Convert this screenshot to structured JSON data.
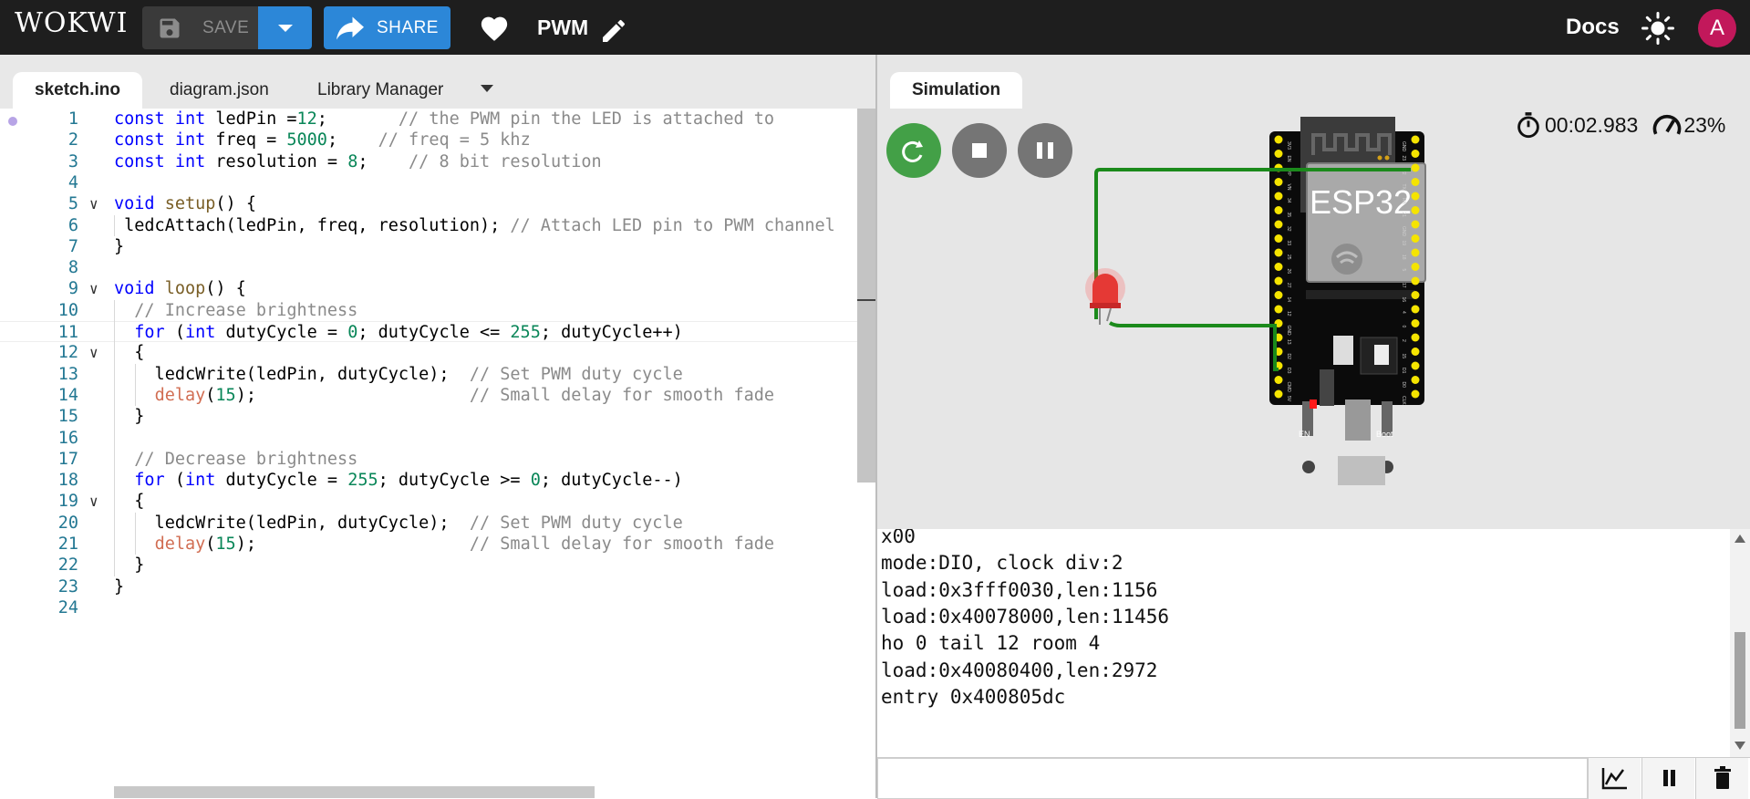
{
  "topbar": {
    "logo": "WOKWI",
    "save_label": "SAVE",
    "share_label": "SHARE",
    "project_name": "PWM",
    "docs_label": "Docs",
    "avatar_letter": "A"
  },
  "editor": {
    "tabs": [
      "sketch.ino",
      "diagram.json",
      "Library Manager"
    ],
    "active_tab": "sketch.ino",
    "line_numbers": [
      "1",
      "2",
      "3",
      "4",
      "5",
      "6",
      "7",
      "8",
      "9",
      "10",
      "11",
      "12",
      "13",
      "14",
      "15",
      "16",
      "17",
      "18",
      "19",
      "20",
      "21",
      "22",
      "23",
      "24"
    ],
    "current_line": 11,
    "code_lines": [
      "const int ledPin =12;       // the PWM pin the LED is attached to",
      "const int freq = 5000;    // freq = 5 khz",
      "const int resolution = 8;    // 8 bit resolution",
      "",
      "void setup() {",
      " ledcAttach(ledPin, freq, resolution); // Attach LED pin to PWM channel",
      "}",
      "",
      "void loop() {",
      "  // Increase brightness",
      "  for (int dutyCycle = 0; dutyCycle <= 255; dutyCycle++)",
      "  {",
      "    ledcWrite(ledPin, dutyCycle);  // Set PWM duty cycle",
      "    delay(15);                     // Small delay for smooth fade",
      "  }",
      "",
      "  // Decrease brightness",
      "  for (int dutyCycle = 255; dutyCycle >= 0; dutyCycle--)",
      "  {",
      "    ledcWrite(ledPin, dutyCycle);  // Set PWM duty cycle",
      "    delay(15);                     // Small delay for smooth fade",
      "  }",
      "}",
      ""
    ]
  },
  "simulation": {
    "tab_label": "Simulation",
    "elapsed_time": "00:02.983",
    "speed": "23%",
    "board_label": "ESP32",
    "led_color": "#e53935",
    "wire_color": "#1b8a1b",
    "pin_labels_left": [
      "3V3",
      "EN",
      "VP",
      "VN",
      "34",
      "35",
      "32",
      "33",
      "25",
      "26",
      "27",
      "14",
      "12",
      "GND",
      "13",
      "D2",
      "D3",
      "CMD",
      "5V"
    ],
    "pin_labels_right": [
      "GND",
      "23",
      "22",
      "TX",
      "RX",
      "21",
      "GND",
      "19",
      "18",
      "5",
      "17",
      "16",
      "4",
      "0",
      "2",
      "15",
      "D1",
      "D0",
      "CLK"
    ],
    "button_labels": [
      "EN",
      "Boot"
    ]
  },
  "serial": {
    "lines": [
      "x00",
      "mode:DIO, clock div:2",
      "load:0x3fff0030,len:1156",
      "load:0x40078000,len:11456",
      "ho 0 tail 12 room 4",
      "load:0x40080400,len:2972",
      "entry 0x400805dc"
    ],
    "input_value": ""
  },
  "colors": {
    "topbar_bg": "#1e1e1e",
    "accent_blue": "#2c87d8",
    "restart_green": "#43a047",
    "avatar_bg": "#c2185b"
  },
  "icons": [
    "save-icon",
    "chevron-down-icon",
    "share-icon",
    "heart-icon",
    "pencil-icon",
    "sun-icon",
    "restart-icon",
    "stop-icon",
    "pause-icon",
    "stopwatch-icon",
    "speedometer-icon",
    "chart-icon",
    "pause-icon",
    "trash-icon"
  ]
}
